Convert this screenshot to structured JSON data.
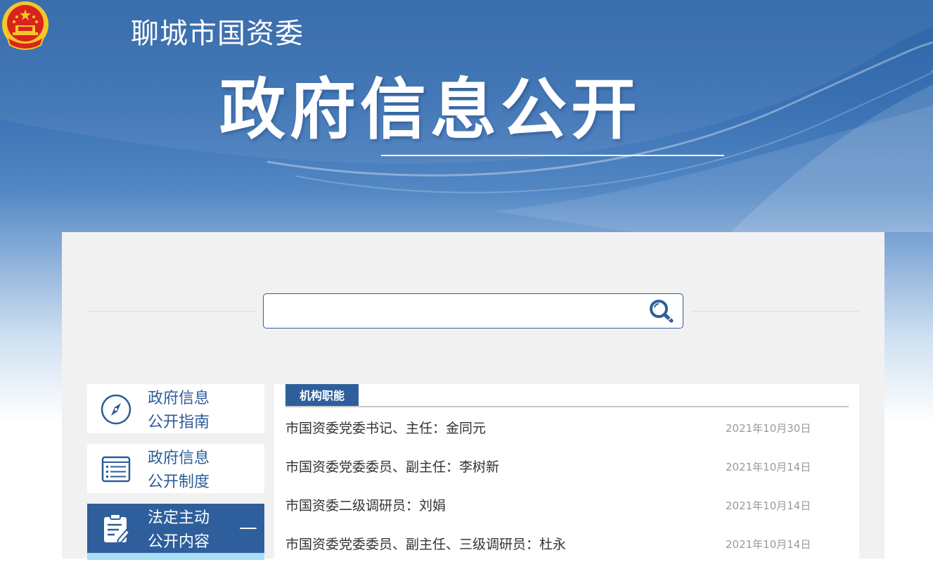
{
  "header": {
    "site_name": "聊城市国资委",
    "banner_title": "政府信息公开"
  },
  "search": {
    "value": "",
    "placeholder": ""
  },
  "sidebar": {
    "items": [
      {
        "line1": "政府信息",
        "line2": "公开指南",
        "icon": "compass-icon",
        "active": false
      },
      {
        "line1": "政府信息",
        "line2": "公开制度",
        "icon": "list-document-icon",
        "active": false
      },
      {
        "line1": "法定主动",
        "line2": "公开内容",
        "icon": "clipboard-edit-icon",
        "active": true,
        "toggle": "—"
      }
    ]
  },
  "content": {
    "section_title": "机构职能",
    "rows": [
      {
        "title": "市国资委党委书记、主任：金同元",
        "date": "2021年10月30日"
      },
      {
        "title": "市国资委党委委员、副主任：李树新",
        "date": "2021年10月14日"
      },
      {
        "title": "市国资委二级调研员：刘娟",
        "date": "2021年10月14日"
      },
      {
        "title": "市国资委党委委员、副主任、三级调研员：杜永",
        "date": "2021年10月14日"
      }
    ]
  },
  "colors": {
    "primary": "#2e5f9c",
    "header_blue": "#2d64a6",
    "panel_bg": "#f1f1f1",
    "sub_menu": "#a9def5",
    "date_gray": "#9a9a9a",
    "emblem_red": "#d9231b",
    "emblem_gold": "#f4c62a"
  }
}
